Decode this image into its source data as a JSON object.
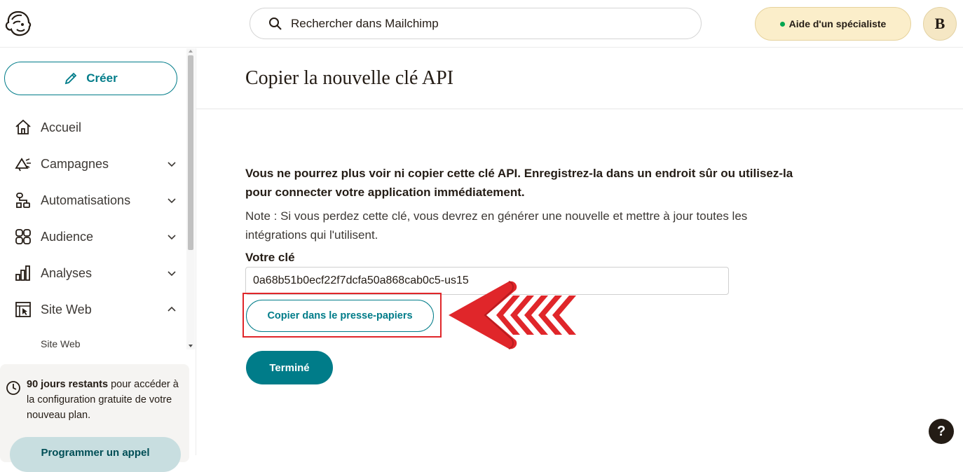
{
  "topbar": {
    "search_placeholder": "Rechercher dans Mailchimp",
    "help_label": "Aide d'un spécialiste",
    "avatar_initial": "B"
  },
  "sidebar": {
    "create_label": "Créer",
    "items": [
      {
        "label": "Accueil",
        "icon": "home-icon",
        "chevron": "none"
      },
      {
        "label": "Campagnes",
        "icon": "megaphone-icon",
        "chevron": "down"
      },
      {
        "label": "Automatisations",
        "icon": "automation-icon",
        "chevron": "down"
      },
      {
        "label": "Audience",
        "icon": "audience-icon",
        "chevron": "down"
      },
      {
        "label": "Analyses",
        "icon": "analytics-icon",
        "chevron": "down"
      },
      {
        "label": "Site Web",
        "icon": "website-icon",
        "chevron": "up"
      }
    ],
    "subitem": "Site Web",
    "trial": {
      "days_bold": "90 jours restants",
      "rest": " pour accéder à la configuration gratuite de votre nouveau plan.",
      "call_button": "Programmer un appel"
    }
  },
  "main": {
    "title": "Copier la nouvelle clé API",
    "warning": "Vous ne pourrez plus voir ni copier cette clé API. Enregistrez-la dans un endroit sûr ou utilisez-la pour connecter votre application immédiatement.",
    "note": "Note : Si vous perdez cette clé, vous devrez en générer une nouvelle et mettre à jour toutes les intégrations qui l'utilisent.",
    "key_label": "Votre clé",
    "key_value": "0a68b51b0ecf22f7dcfa50a868cab0c5-us15",
    "copy_button": "Copier dans le presse-papiers",
    "done_button": "Terminé"
  },
  "help_fab": "?",
  "colors": {
    "accent": "#007c89",
    "annotation_red": "#e0262a",
    "help_bg": "#fbeeca"
  }
}
